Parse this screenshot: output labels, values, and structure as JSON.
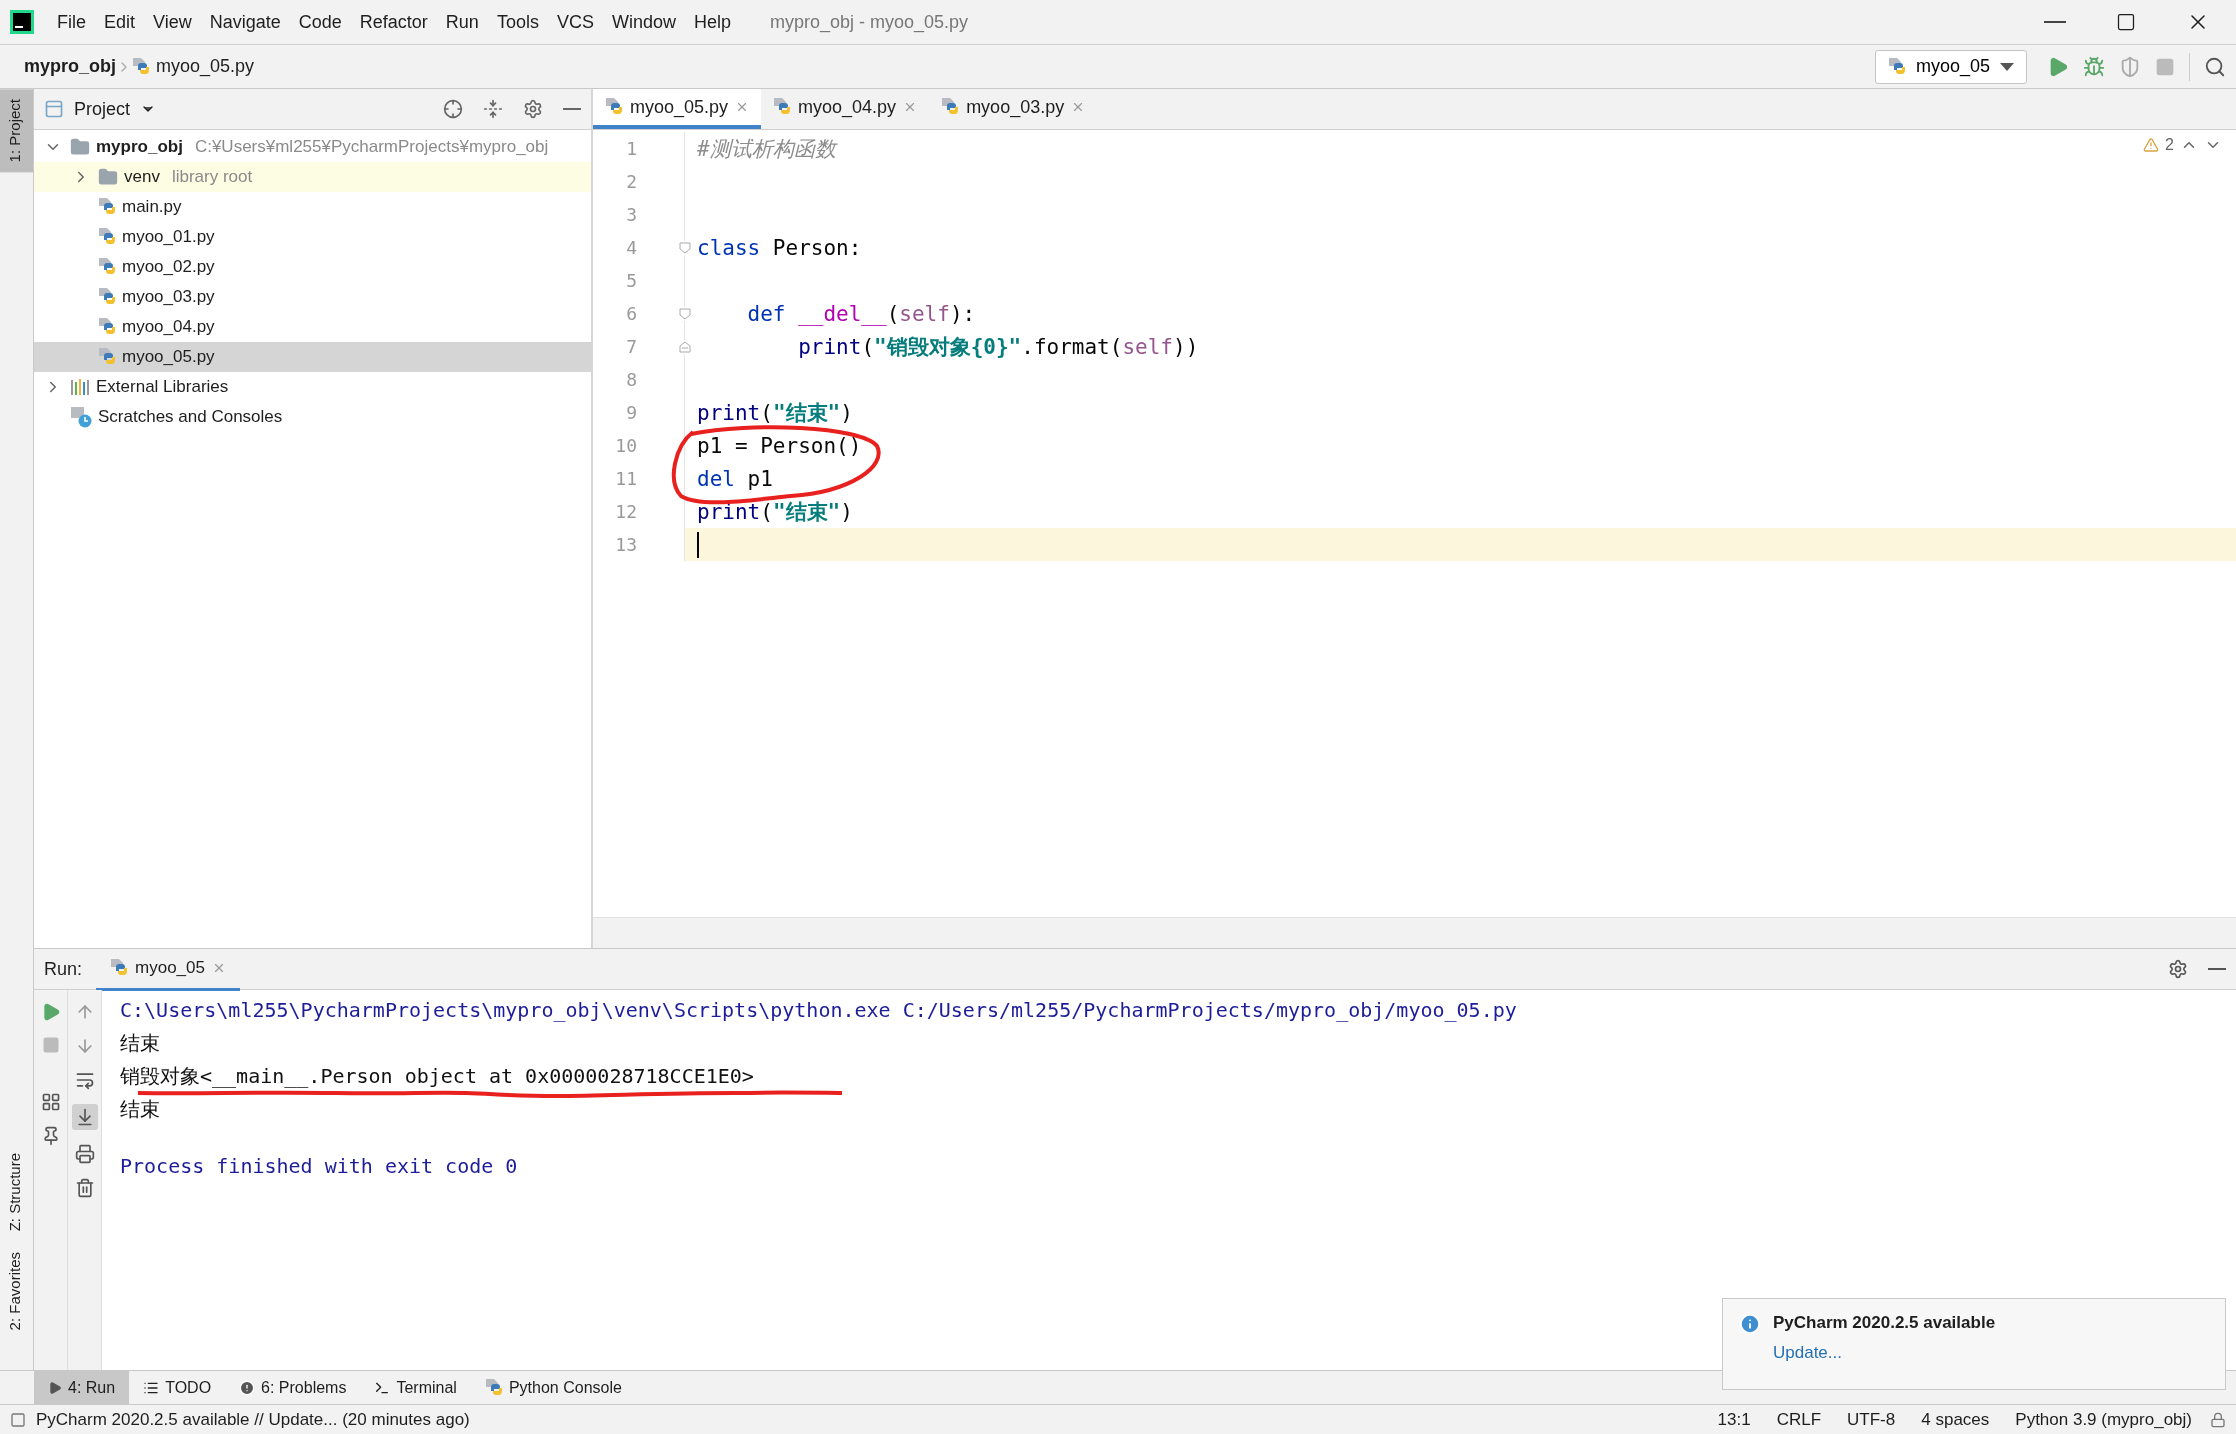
{
  "window": {
    "title": "mypro_obj - myoo_05.py",
    "menu": [
      "File",
      "Edit",
      "View",
      "Navigate",
      "Code",
      "Refactor",
      "Run",
      "Tools",
      "VCS",
      "Window",
      "Help"
    ]
  },
  "navbar": {
    "breadcrumbs": [
      {
        "label": "mypro_obj",
        "kind": "project"
      },
      {
        "label": "myoo_05.py",
        "kind": "file"
      }
    ],
    "run_config": "myoo_05"
  },
  "left_stripe": {
    "top": [
      {
        "label": "1: Project",
        "selected": true
      }
    ],
    "bottom": [
      {
        "label": "Z: Structure",
        "selected": false
      },
      {
        "label": "2: Favorites",
        "selected": false
      }
    ]
  },
  "project": {
    "title": "Project",
    "tree": [
      {
        "label": "mypro_obj",
        "hint": "C:¥Users¥ml255¥PycharmProjects¥mypro_obj",
        "kind": "folder",
        "expanded": true,
        "selected": false,
        "highlighted": false,
        "children": [
          {
            "label": "venv",
            "hint": "library root",
            "kind": "folder",
            "expanded": false,
            "selected": false,
            "highlighted": true
          },
          {
            "label": "main.py",
            "kind": "python",
            "selected": false,
            "highlighted": false
          },
          {
            "label": "myoo_01.py",
            "kind": "python",
            "selected": false,
            "highlighted": false
          },
          {
            "label": "myoo_02.py",
            "kind": "python",
            "selected": false,
            "highlighted": false
          },
          {
            "label": "myoo_03.py",
            "kind": "python",
            "selected": false,
            "highlighted": false
          },
          {
            "label": "myoo_04.py",
            "kind": "python",
            "selected": false,
            "highlighted": false
          },
          {
            "label": "myoo_05.py",
            "kind": "python",
            "selected": true,
            "highlighted": false
          }
        ]
      },
      {
        "label": "External Libraries",
        "kind": "libraries",
        "expanded": false,
        "selected": false,
        "highlighted": false
      },
      {
        "label": "Scratches and Consoles",
        "kind": "scratches",
        "selected": false,
        "highlighted": false
      }
    ]
  },
  "editor": {
    "tabs": [
      {
        "label": "myoo_05.py",
        "selected": true
      },
      {
        "label": "myoo_04.py",
        "selected": false
      },
      {
        "label": "myoo_03.py",
        "selected": false
      }
    ],
    "warnings": "2",
    "lines": [
      {
        "number": "1",
        "kind": "plain",
        "current": false,
        "tokens": [
          {
            "kind": "comment",
            "text": "#测试析构函数"
          }
        ]
      },
      {
        "number": "2",
        "kind": "plain",
        "current": false
      },
      {
        "number": "3",
        "kind": "plain",
        "current": false
      },
      {
        "number": "4",
        "kind": "opener",
        "current": false,
        "tokens": [
          {
            "kind": "keyword",
            "text": "class"
          },
          {
            "kind": "plain",
            "text": " Person:"
          }
        ]
      },
      {
        "number": "5",
        "kind": "plain",
        "current": false
      },
      {
        "number": "6",
        "kind": "opener",
        "current": false,
        "tokens": [
          {
            "kind": "keyword",
            "text": "    def"
          },
          {
            "kind": "magic",
            "text": " __del__"
          },
          {
            "kind": "plain",
            "text": "("
          },
          {
            "kind": "self",
            "text": "self"
          },
          {
            "kind": "plain",
            "text": "):"
          }
        ]
      },
      {
        "number": "7",
        "kind": "closer",
        "current": false,
        "tokens": [
          {
            "kind": "builtin",
            "text": "        print"
          },
          {
            "kind": "plain",
            "text": "("
          },
          {
            "kind": "string",
            "text": "\"销毁对象{0}\""
          },
          {
            "kind": "plain",
            "text": ".format("
          },
          {
            "kind": "self",
            "text": "self"
          },
          {
            "kind": "plain",
            "text": "))"
          }
        ]
      },
      {
        "number": "8",
        "kind": "plain",
        "current": false
      },
      {
        "number": "9",
        "kind": "plain",
        "current": false,
        "tokens": [
          {
            "kind": "builtin",
            "text": "print"
          },
          {
            "kind": "plain",
            "text": "("
          },
          {
            "kind": "string",
            "text": "\"结束\""
          },
          {
            "kind": "plain",
            "text": ")"
          }
        ]
      },
      {
        "number": "10",
        "kind": "plain",
        "current": false,
        "tokens": [
          {
            "kind": "plain",
            "text": "p1 = Person()"
          }
        ]
      },
      {
        "number": "11",
        "kind": "plain",
        "current": false,
        "tokens": [
          {
            "kind": "keyword",
            "text": "del"
          },
          {
            "kind": "plain",
            "text": " p1"
          }
        ]
      },
      {
        "number": "12",
        "kind": "plain",
        "current": false,
        "tokens": [
          {
            "kind": "builtin",
            "text": "print"
          },
          {
            "kind": "plain",
            "text": "("
          },
          {
            "kind": "string",
            "text": "\"结束\""
          },
          {
            "kind": "plain",
            "text": ")"
          }
        ]
      },
      {
        "number": "13",
        "kind": "plain",
        "current": true
      }
    ]
  },
  "run": {
    "label": "Run:",
    "tab": "myoo_05",
    "output": [
      {
        "kind": "command",
        "text": "C:\\Users\\ml255\\PycharmProjects\\mypro_obj\\venv\\Scripts\\python.exe C:/Users/ml255/PycharmProjects/mypro_obj/myoo_05.py"
      },
      {
        "kind": "output",
        "text": "结束"
      },
      {
        "kind": "output",
        "text": "销毁对象<__main__.Person object at 0x0000028718CCE1E0>"
      },
      {
        "kind": "output",
        "text": "结束"
      },
      {
        "kind": "exit",
        "text": "Process finished with exit code 0"
      }
    ]
  },
  "tool_tabs": [
    {
      "label": "4: Run",
      "kind": "run",
      "selected": true
    },
    {
      "label": "TODO",
      "kind": "todo",
      "selected": false
    },
    {
      "label": "6: Problems",
      "kind": "problems",
      "selected": false
    },
    {
      "label": "Terminal",
      "kind": "terminal",
      "selected": false
    },
    {
      "label": "Python Console",
      "kind": "console",
      "selected": false
    }
  ],
  "notification": {
    "title": "PyCharm 2020.2.5 available",
    "link": "Update..."
  },
  "status_bar": {
    "message": "PyCharm 2020.2.5 available // Update... (20 minutes ago)",
    "items": [
      "13:1",
      "CRLF",
      "UTF-8",
      "4 spaces",
      "Python 3.9 (mypro_obj)"
    ]
  }
}
